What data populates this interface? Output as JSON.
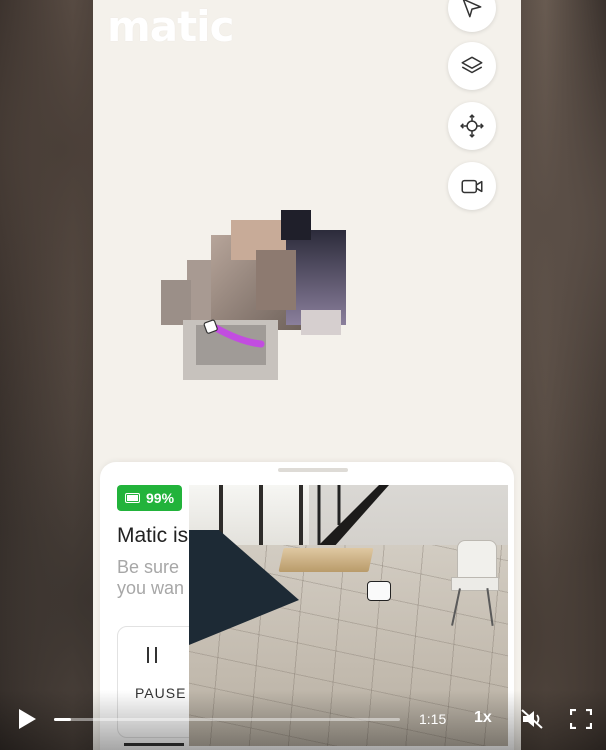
{
  "app": {
    "logo": "matic"
  },
  "map_controls": [
    {
      "name": "navigate-icon"
    },
    {
      "name": "layers-icon"
    },
    {
      "name": "recenter-icon"
    },
    {
      "name": "camera-icon"
    }
  ],
  "sheet": {
    "battery": "99%",
    "status_title": "Matic is",
    "status_sub_line1": "Be sure",
    "status_sub_line2": "you wan",
    "pause_label": "PAUSE"
  },
  "video": {
    "time": "1:15",
    "speed": "1x",
    "progress": 0.05
  },
  "colors": {
    "battery_green": "#22b33b",
    "map_background": "#f4f1eb",
    "path_purple": "#c24de0"
  }
}
